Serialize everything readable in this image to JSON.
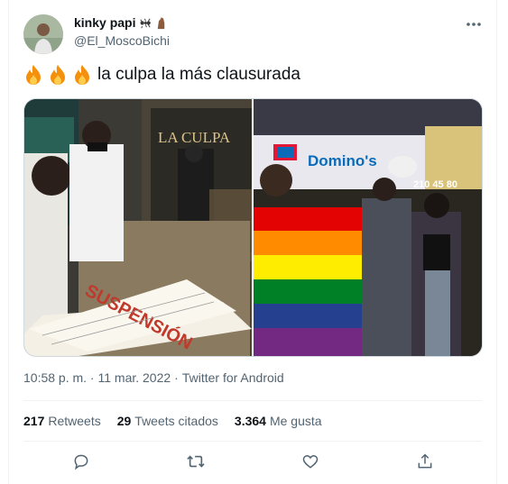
{
  "tweet": {
    "author": {
      "display_name": "kinky papi",
      "handle": "@El_MoscoBichi"
    },
    "text": "la culpa la más clausurada",
    "emoji_prefix_icons": [
      "fire-icon",
      "fire-icon",
      "fire-icon"
    ],
    "media": {
      "photo_left": {
        "sign_text": "LA CULPA",
        "stamp_text": "SUSPENSIÓN"
      },
      "photo_right": {
        "sign_text": "Domino's",
        "number_text": "210 45 80"
      }
    },
    "timestamp": "10:58 p. m. · 11 mar. 2022",
    "separator": "·",
    "client": "Twitter for Android",
    "stats": {
      "retweets_count": "217",
      "retweets_label": "Retweets",
      "quotes_count": "29",
      "quotes_label": "Tweets citados",
      "likes_count": "3.364",
      "likes_label": "Me gusta"
    }
  },
  "colors": {
    "text": "#0f1419",
    "muted": "#536471",
    "divider": "#eff3f4"
  }
}
